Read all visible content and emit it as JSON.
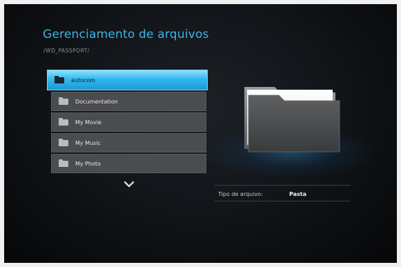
{
  "header": {
    "title": "Gerenciamento de arquivos",
    "path": "/WD_PASSPORT/"
  },
  "file_list": {
    "selected_index": 0,
    "items": [
      {
        "label": "autocom",
        "icon": "folder-icon"
      },
      {
        "label": "Documentation",
        "icon": "folder-icon"
      },
      {
        "label": "My Movie",
        "icon": "folder-icon"
      },
      {
        "label": "My Music",
        "icon": "folder-icon"
      },
      {
        "label": "My Photo",
        "icon": "folder-icon"
      }
    ],
    "more_icon": "chevron-down-icon"
  },
  "preview": {
    "icon": "large-folder-icon"
  },
  "info": {
    "type_label": "Tipo de arquivo:",
    "type_value": "Pasta"
  },
  "colors": {
    "accent": "#3fb4e8",
    "selection": "#34b8ef",
    "item_bg": "#4a4c4e"
  }
}
